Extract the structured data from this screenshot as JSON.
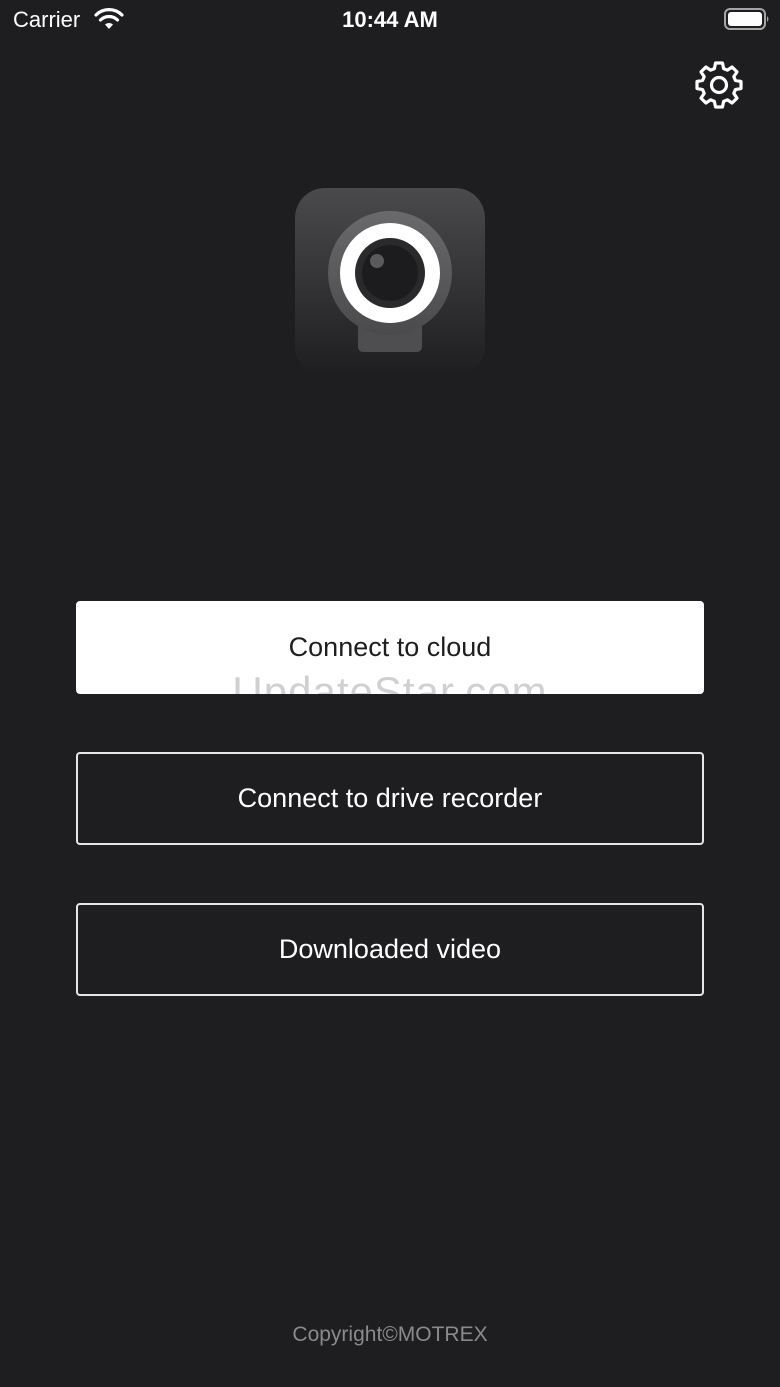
{
  "status_bar": {
    "carrier": "Carrier",
    "time": "10:44 AM"
  },
  "icons": {
    "wifi": "wifi-icon",
    "battery": "battery-icon",
    "settings": "gear-icon",
    "logo": "dashcam-logo-icon"
  },
  "buttons": {
    "cloud": "Connect to cloud",
    "drive_recorder": "Connect to drive recorder",
    "downloaded": "Downloaded video"
  },
  "watermark": "UpdateStar.com",
  "footer": {
    "copyright": "Copyright©MOTREX"
  },
  "colors": {
    "background": "#1e1e20",
    "primary_button": "#ffffff",
    "outline": "#e6e6e6",
    "footer_text": "#8a8a8c"
  }
}
